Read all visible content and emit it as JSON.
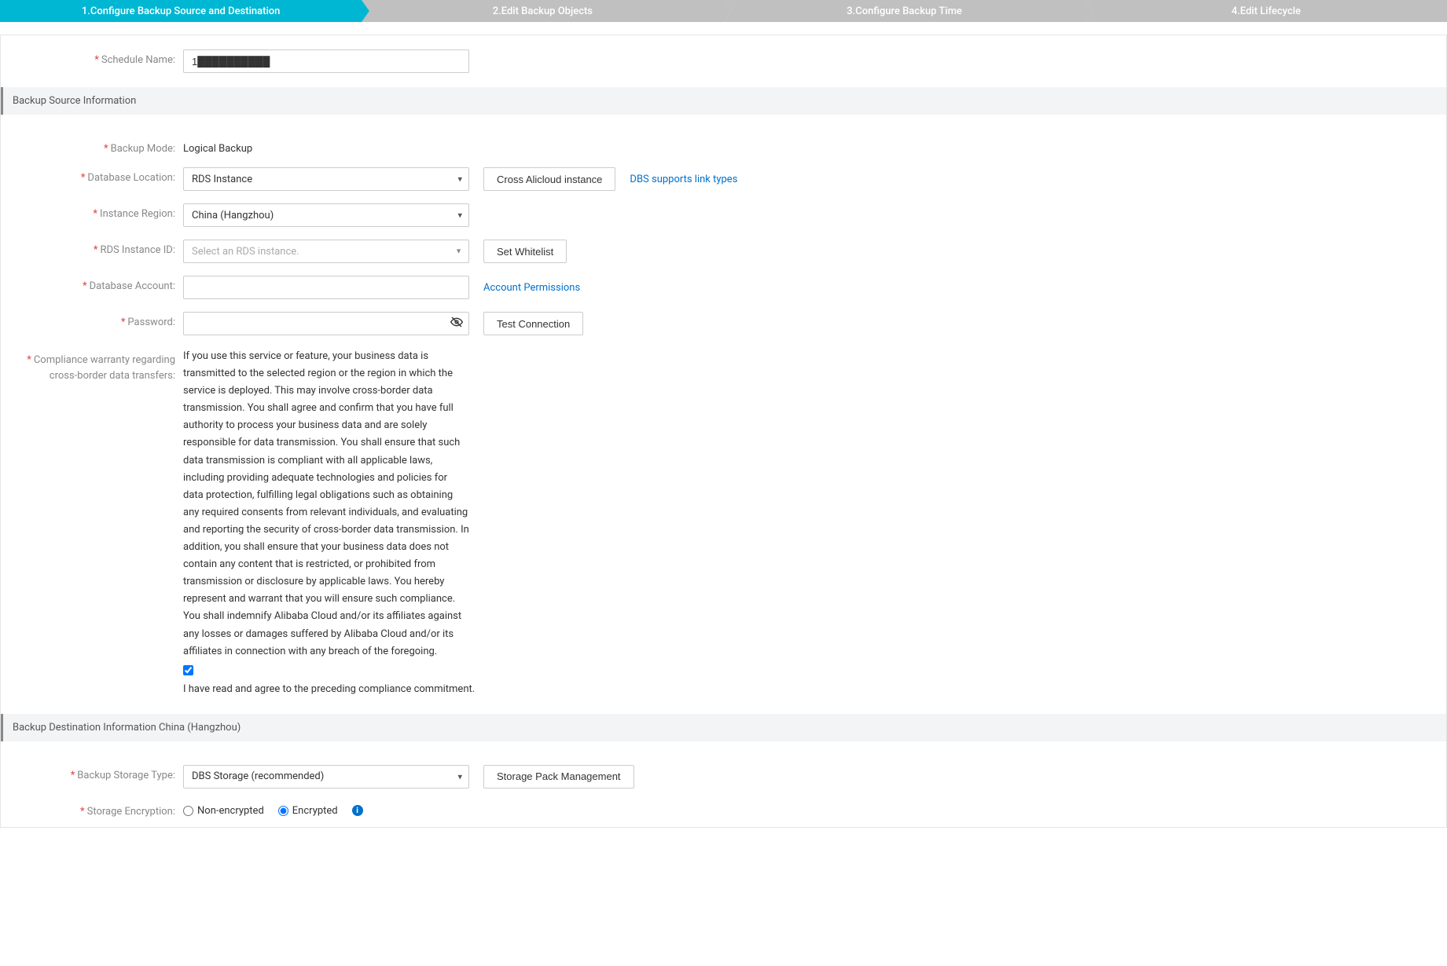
{
  "steps": [
    "1.Configure Backup Source and Destination",
    "2.Edit Backup Objects",
    "3.Configure Backup Time",
    "4.Edit Lifecycle"
  ],
  "schedule": {
    "label": "Schedule Name:",
    "value": "1██████████"
  },
  "source": {
    "header": "Backup Source Information",
    "mode_label": "Backup Mode:",
    "mode_value": "Logical Backup",
    "location_label": "Database Location:",
    "location_value": "RDS Instance",
    "cross_button": "Cross Alicloud instance",
    "link_support": "DBS supports link types",
    "region_label": "Instance Region:",
    "region_value": "China (Hangzhou)",
    "instance_id_label": "RDS Instance ID:",
    "instance_id_placeholder": "Select an RDS instance.",
    "whitelist_button": "Set Whitelist",
    "account_label": "Database Account:",
    "account_value": "",
    "perm_link": "Account Permissions",
    "password_label": "Password:",
    "test_button": "Test Connection",
    "compliance_label": "Compliance warranty regarding cross-border data transfers:",
    "compliance_text": "If you use this service or feature, your business data is transmitted to the selected region or the region in which the service is deployed. This may involve cross-border data transmission. You shall agree and confirm that you have full authority to process your business data and are solely responsible for data transmission. You shall ensure that such data transmission is compliant with all applicable laws, including providing adequate technologies and policies for data protection, fulfilling legal obligations such as obtaining any required consents from relevant individuals, and evaluating and reporting the security of cross-border data transmission. In addition, you shall ensure that your business data does not contain any content that is restricted, or prohibited from transmission or disclosure by applicable laws. You hereby represent and warrant that you will ensure such compliance. You shall indemnify Alibaba Cloud and/or its affiliates against any losses or damages suffered by Alibaba Cloud and/or its affiliates in connection with any breach of the foregoing.",
    "agree_label": " I have read and agree to the preceding compliance commitment."
  },
  "dest": {
    "header": "Backup Destination Information  China (Hangzhou)",
    "storage_type_label": "Backup Storage Type:",
    "storage_type_value": "DBS Storage (recommended)",
    "storage_pack_button": "Storage Pack Management",
    "encryption_label": "Storage Encryption:",
    "enc_none": "Non-encrypted",
    "enc_yes": "Encrypted"
  }
}
